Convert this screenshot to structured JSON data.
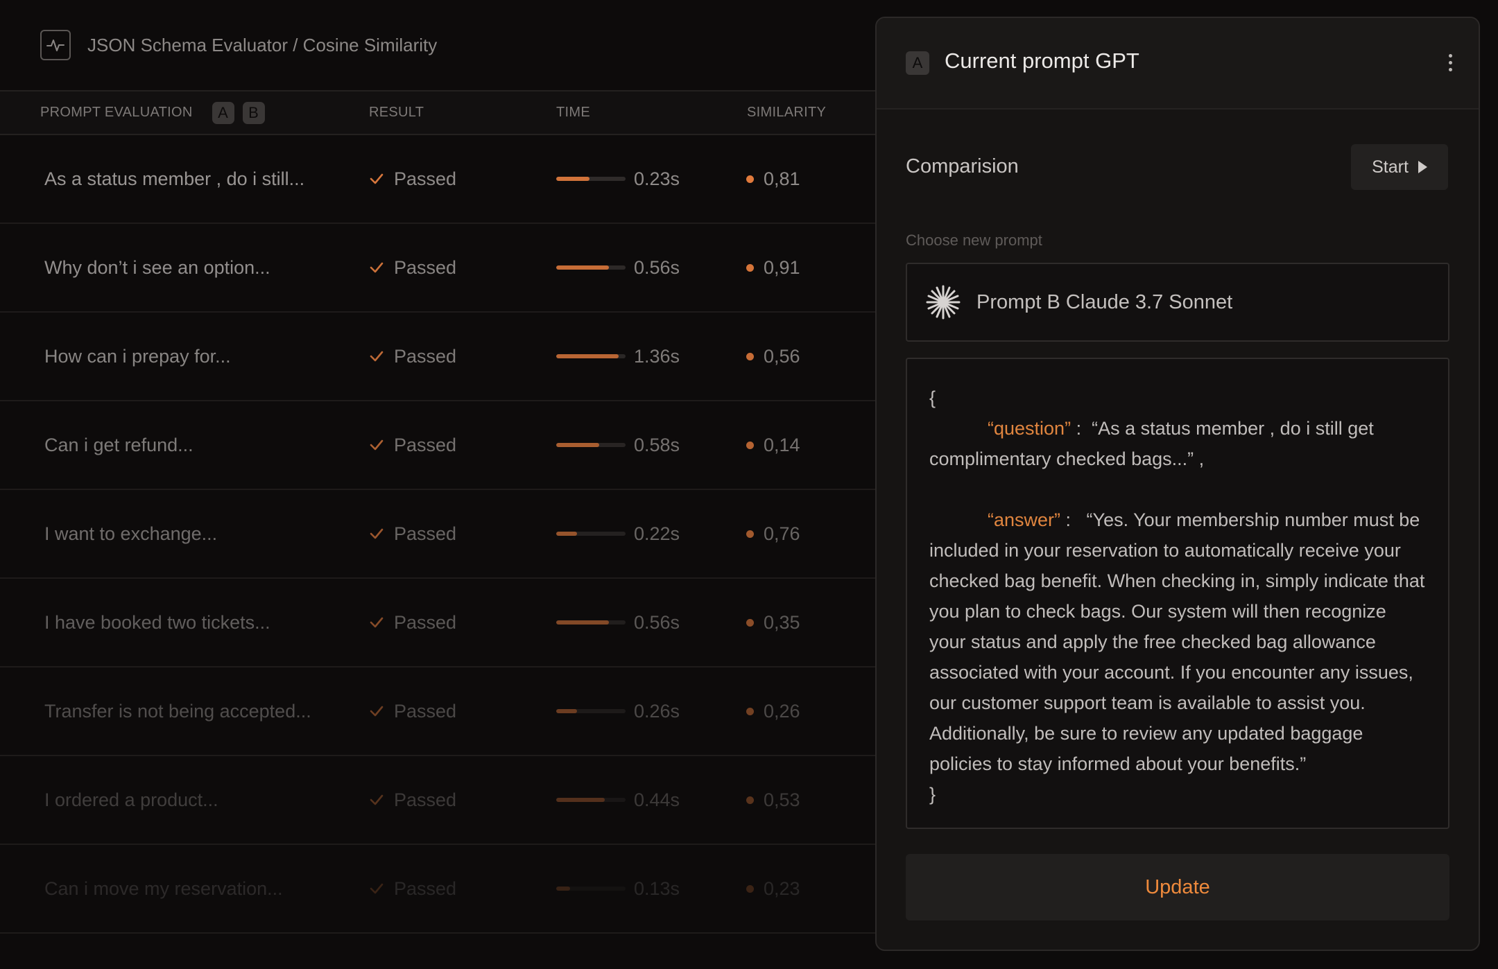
{
  "header": {
    "title": "JSON Schema Evaluator / Cosine Similarity",
    "icon": "activity-pulse-icon"
  },
  "table": {
    "columns": {
      "prompt": "PROMPT EVALUATION",
      "badge_a": "A",
      "badge_b": "B",
      "result": "RESULT",
      "time": "TIME",
      "similarity": "SIMILARITY"
    },
    "rows": [
      {
        "question": "As a status member , do i still...",
        "result": "Passed",
        "time": "0.23s",
        "time_fraction": 0.48,
        "similarity": "0,81"
      },
      {
        "question": "Why don’t i see an option...",
        "result": "Passed",
        "time": "0.56s",
        "time_fraction": 0.76,
        "similarity": "0,91"
      },
      {
        "question": "How can i prepay for...",
        "result": "Passed",
        "time": "1.36s",
        "time_fraction": 0.9,
        "similarity": "0,56"
      },
      {
        "question": "Can i get refund...",
        "result": "Passed",
        "time": "0.58s",
        "time_fraction": 0.62,
        "similarity": "0,14"
      },
      {
        "question": "I want to exchange...",
        "result": "Passed",
        "time": "0.22s",
        "time_fraction": 0.3,
        "similarity": "0,76"
      },
      {
        "question": "I have booked two tickets...",
        "result": "Passed",
        "time": "0.56s",
        "time_fraction": 0.76,
        "similarity": "0,35"
      },
      {
        "question": "Transfer is not being accepted...",
        "result": "Passed",
        "time": "0.26s",
        "time_fraction": 0.3,
        "similarity": "0,26"
      },
      {
        "question": "I ordered a product...",
        "result": "Passed",
        "time": "0.44s",
        "time_fraction": 0.7,
        "similarity": "0,53"
      },
      {
        "question": "Can i move my reservation...",
        "result": "Passed",
        "time": "0.13s",
        "time_fraction": 0.2,
        "similarity": "0,23"
      }
    ]
  },
  "panel": {
    "badge": "A",
    "title": "Current prompt GPT",
    "comparison_label": "Comparision",
    "start_label": "Start",
    "choose_label": "Choose new prompt",
    "selected_prompt": "Prompt B Claude 3.7 Sonnet",
    "selected_prompt_icon": "claude-asterisk-icon",
    "json": {
      "open": "{",
      "question_key": "“question”",
      "question_sep": " :  ",
      "question_value": "“As a status member , do i still get complimentary checked bags...” ,",
      "answer_key": "“answer”",
      "answer_sep": " :   ",
      "answer_value": "“Yes. Your membership number must be included in your reservation to automatically receive your checked bag benefit. When checking in, simply indicate that you plan to check bags. Our system will then recognize your status and apply the free checked bag allowance associated with your account. If you encounter any issues, our customer support team is available to assist you. Additionally, be sure to review any updated baggage policies to stay informed about your benefits.”",
      "close": "}"
    },
    "update_label": "Update"
  },
  "colors": {
    "accent": "#e07a3c",
    "background": "#0d0b0b",
    "panel": "#161413"
  }
}
